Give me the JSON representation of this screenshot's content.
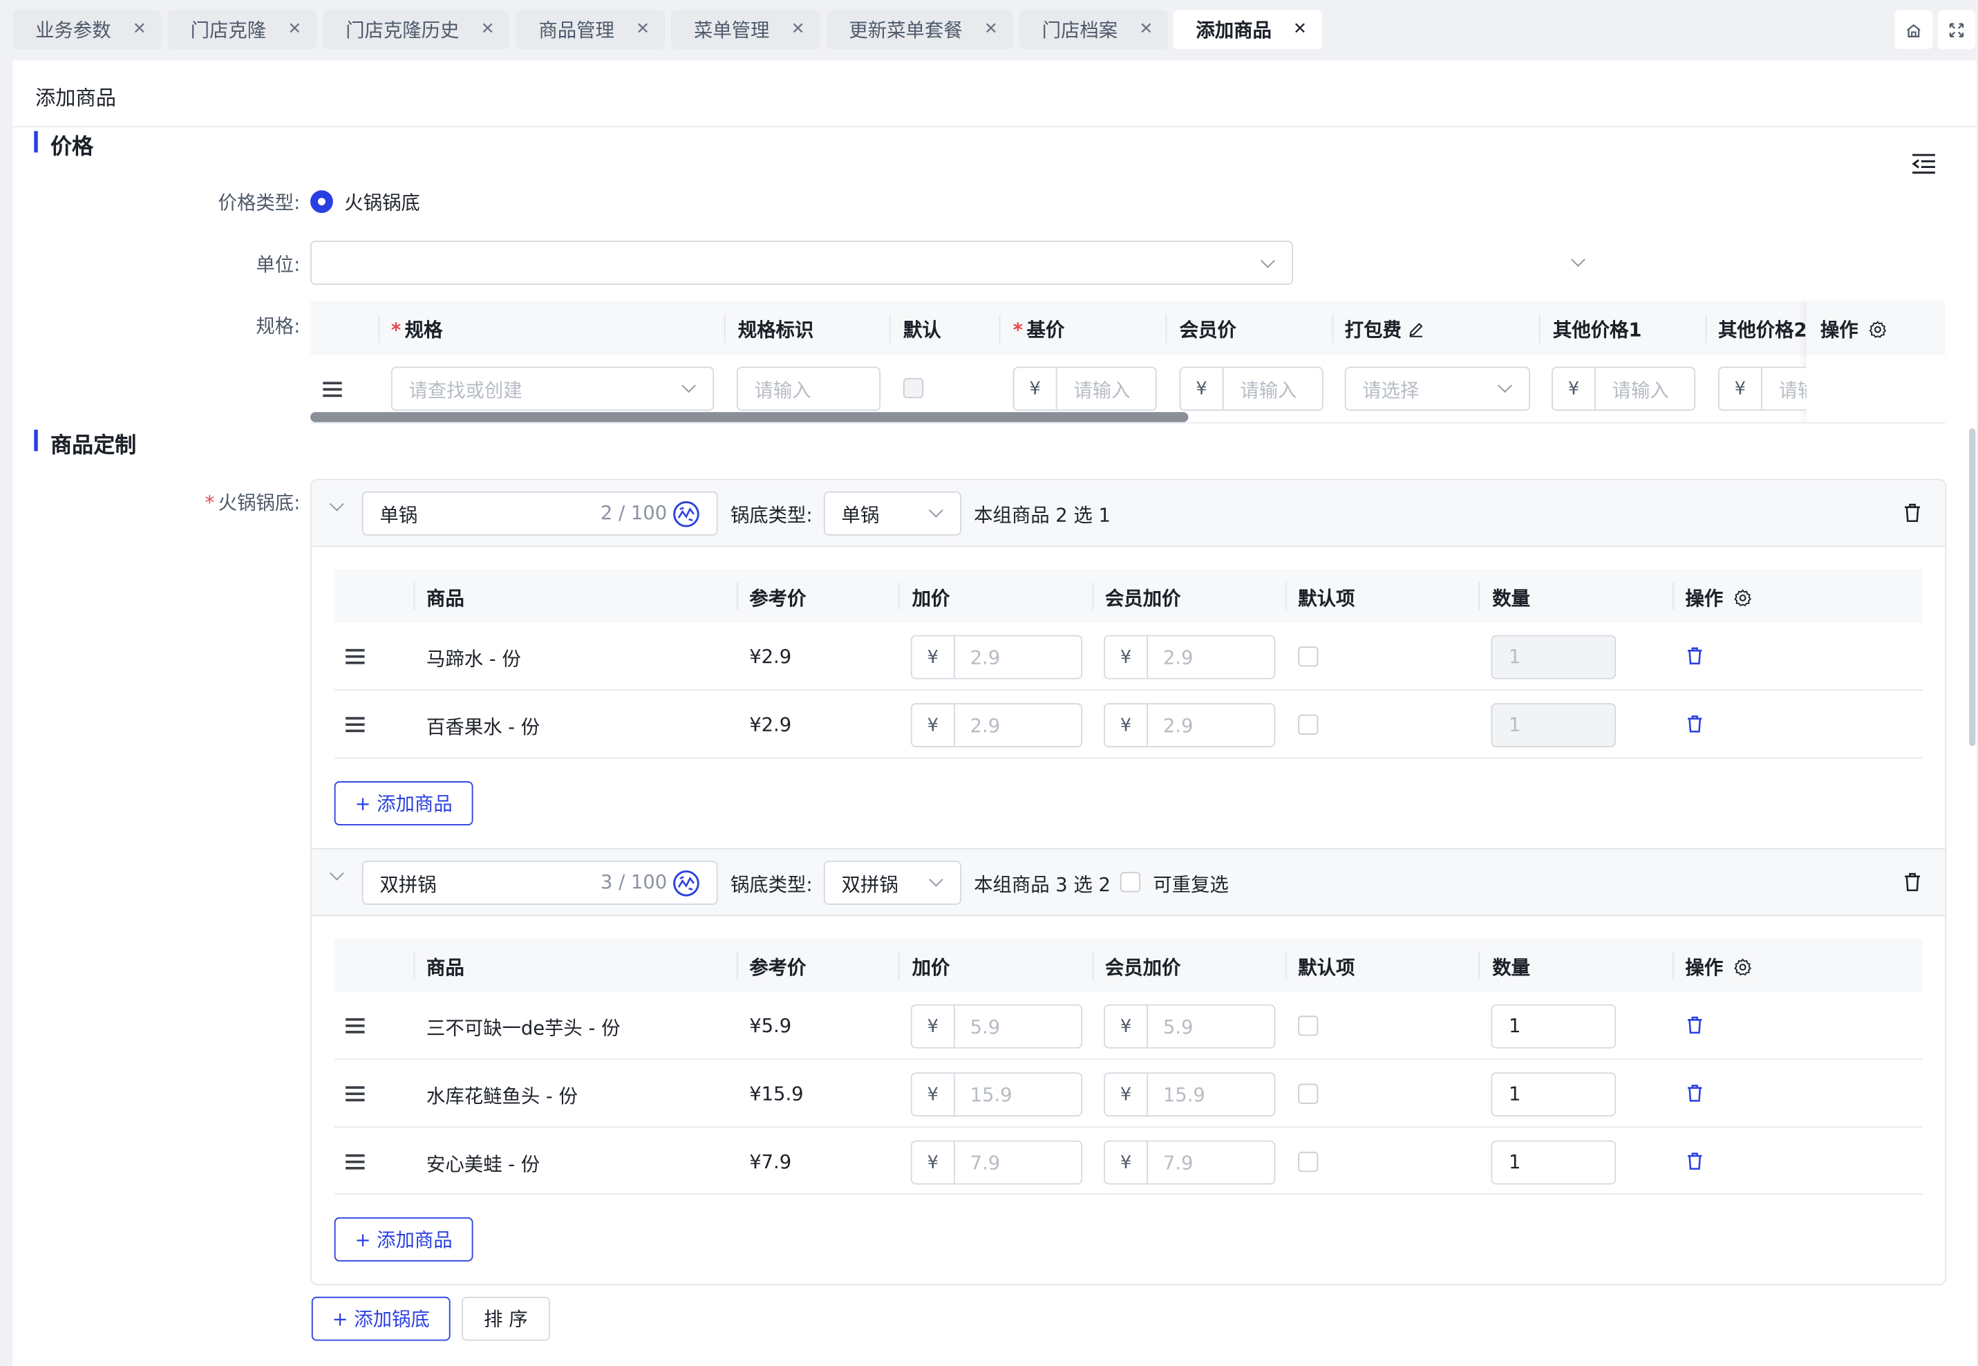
{
  "tabs": [
    "业务参数",
    "门店克隆",
    "门店克隆历史",
    "商品管理",
    "菜单管理",
    "更新菜单套餐",
    "门店档案",
    "添加商品"
  ],
  "page_title": "添加商品",
  "price_section": {
    "title": "价格",
    "price_type_label": "价格类型:",
    "price_type_option": "火锅锅底",
    "unit_label": "单位:",
    "spec_label": "规格:",
    "spec_table": {
      "headers": [
        "规格",
        "规格标识",
        "默认",
        "基价",
        "会员价",
        "打包费",
        "其他价格1",
        "其他价格2",
        "操作"
      ],
      "spec_placeholder": "请查找或创建",
      "input_placeholder": "请输入",
      "select_placeholder": "请选择",
      "truncated_placeholder": "请输",
      "currency": "¥"
    }
  },
  "custom_section": {
    "title": "商品定制",
    "field_label": "火锅锅底:",
    "pot_type_label": "锅底类型:",
    "groups": [
      {
        "name": "单锅",
        "count": "2 / 100",
        "pot_type": "单锅",
        "summary": "本组商品 2 选 1",
        "headers": [
          "商品",
          "参考价",
          "加价",
          "会员加价",
          "默认项",
          "数量",
          "操作"
        ],
        "rows": [
          {
            "name": "马蹄水 - 份",
            "ref": "¥2.9",
            "add": "2.9",
            "member": "2.9",
            "qty": "1"
          },
          {
            "name": "百香果水 - 份",
            "ref": "¥2.9",
            "add": "2.9",
            "member": "2.9",
            "qty": "1"
          }
        ],
        "add_label": "+ 添加商品"
      },
      {
        "name": "双拼锅",
        "count": "3 / 100",
        "pot_type": "双拼锅",
        "summary": "本组商品 3 选 2",
        "repeat_label": "可重复选",
        "headers": [
          "商品",
          "参考价",
          "加价",
          "会员加价",
          "默认项",
          "数量",
          "操作"
        ],
        "rows": [
          {
            "name": "三不可缺一de芋头 - 份",
            "ref": "¥5.9",
            "add": "5.9",
            "member": "5.9",
            "qty": "1"
          },
          {
            "name": "水库花鲢鱼头 - 份",
            "ref": "¥15.9",
            "add": "15.9",
            "member": "15.9",
            "qty": "1"
          },
          {
            "name": "安心美蛙 - 份",
            "ref": "¥7.9",
            "add": "7.9",
            "member": "7.9",
            "qty": "1"
          }
        ],
        "add_label": "+ 添加商品"
      }
    ],
    "currency": "¥",
    "add_pot_label": "+ 添加锅底",
    "sort_label": "排 序"
  },
  "colors": {
    "accent": "#2a3fe0",
    "required": "#e5484d",
    "background": "#f0f1f4"
  }
}
